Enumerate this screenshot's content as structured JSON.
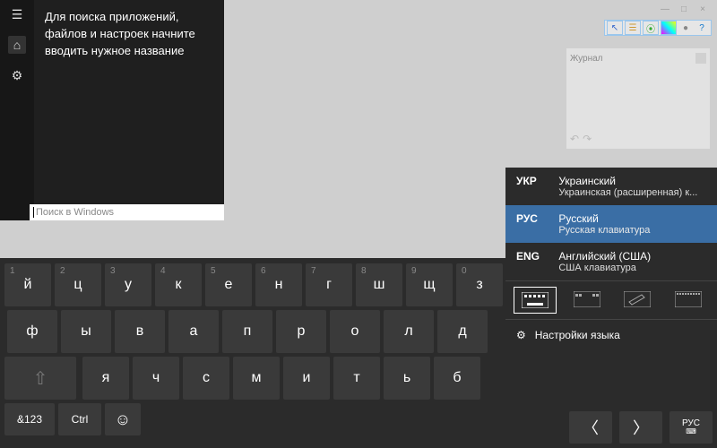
{
  "window_controls": {
    "min": "—",
    "max": "□",
    "close": "×"
  },
  "toolbar": {
    "items": [
      "↖",
      "☰",
      "⦿",
      "◐",
      "●",
      "?"
    ]
  },
  "journal": {
    "title": "Журнал",
    "undo": "↶",
    "redo": "↷"
  },
  "start": {
    "message": "Для поиска приложений, файлов и настроек начните вводить нужное название",
    "search_placeholder": "Поиск в Windows"
  },
  "keyboard": {
    "row1_nums": [
      "1",
      "2",
      "3",
      "4",
      "5",
      "6",
      "7",
      "8",
      "9",
      "0"
    ],
    "row1_letters": [
      "й",
      "ц",
      "у",
      "к",
      "е",
      "н",
      "г",
      "ш",
      "щ",
      "з"
    ],
    "row2": [
      "ф",
      "ы",
      "в",
      "а",
      "п",
      "р",
      "о",
      "л",
      "д"
    ],
    "row3": [
      "я",
      "ч",
      "с",
      "м",
      "и",
      "т",
      "ь",
      "б"
    ],
    "sym": "&123",
    "ctrl": "Ctrl",
    "emoji": "☺"
  },
  "ime": {
    "items": [
      {
        "code": "УКР",
        "name": "Украинский",
        "detail": "Украинская (расширенная) к..."
      },
      {
        "code": "РУС",
        "name": "Русский",
        "detail": "Русская клавиатура"
      },
      {
        "code": "ENG",
        "name": "Английский (США)",
        "detail": "США клавиатура"
      }
    ],
    "settings": "Настройки языка",
    "lang_short": "РУС"
  },
  "nav": {
    "prev": "〈",
    "next": "〉"
  }
}
